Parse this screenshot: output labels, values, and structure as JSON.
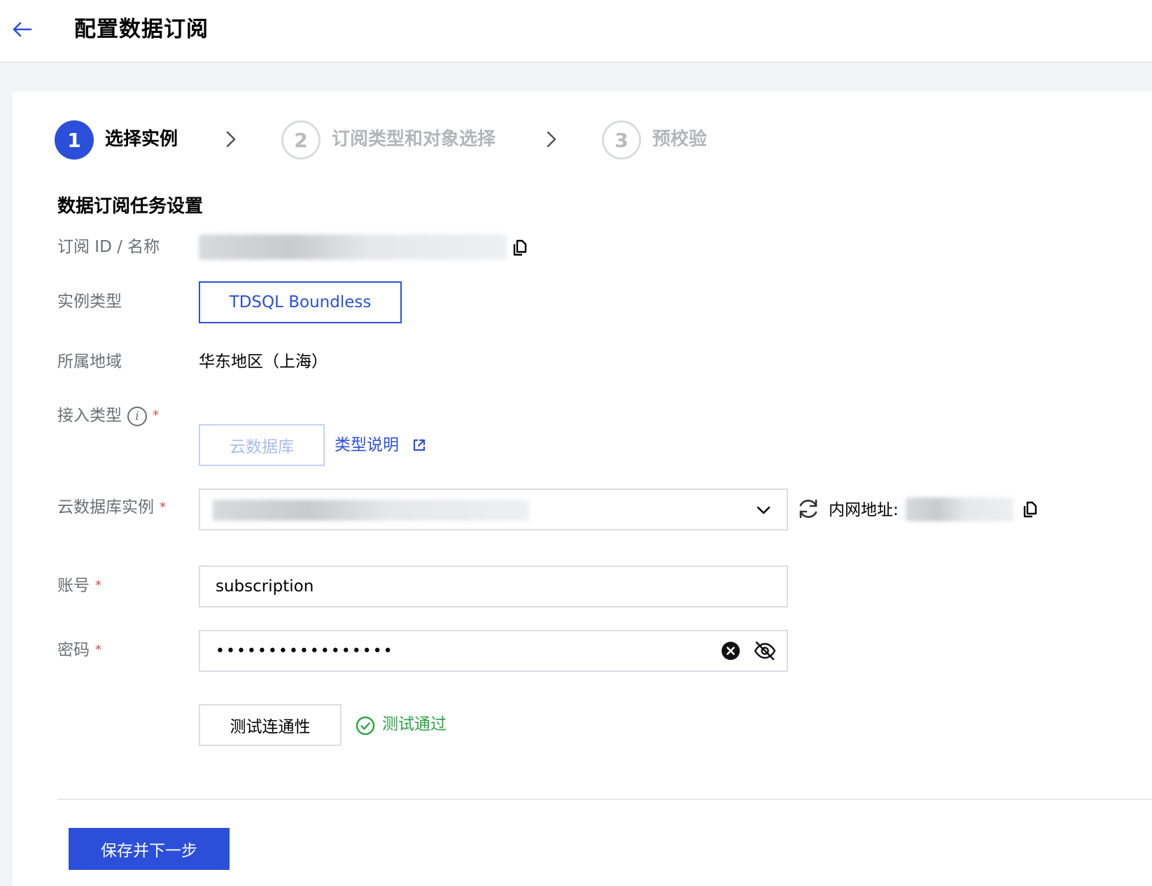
{
  "header": {
    "title": "配置数据订阅"
  },
  "steps": [
    {
      "number": "1",
      "label": "选择实例",
      "state": "active"
    },
    {
      "number": "2",
      "label": "订阅类型和对象选择",
      "state": "inactive"
    },
    {
      "number": "3",
      "label": "预校验",
      "state": "inactive"
    }
  ],
  "section": {
    "title": "数据订阅任务设置"
  },
  "form": {
    "subscription_id": {
      "label": "订阅 ID / 名称"
    },
    "instance_type": {
      "label": "实例类型",
      "value": "TDSQL Boundless"
    },
    "region": {
      "label": "所属地域",
      "value": "华东地区（上海）"
    },
    "access_type": {
      "label": "接入类型",
      "value": "云数据库",
      "help_link": "类型说明"
    },
    "cloud_instance": {
      "label": "云数据库实例",
      "internal_address_label": "内网地址:"
    },
    "account": {
      "label": "账号",
      "value": "subscription"
    },
    "password": {
      "label": "密码",
      "value": "•••••••••••••••••"
    },
    "required_mark": "*"
  },
  "test": {
    "button_label": "测试连通性",
    "result": "测试通过"
  },
  "footer": {
    "primary_label": "保存并下一步"
  },
  "colors": {
    "primary": "#2b4fd9",
    "success": "#2ba441",
    "required": "#e54545"
  }
}
